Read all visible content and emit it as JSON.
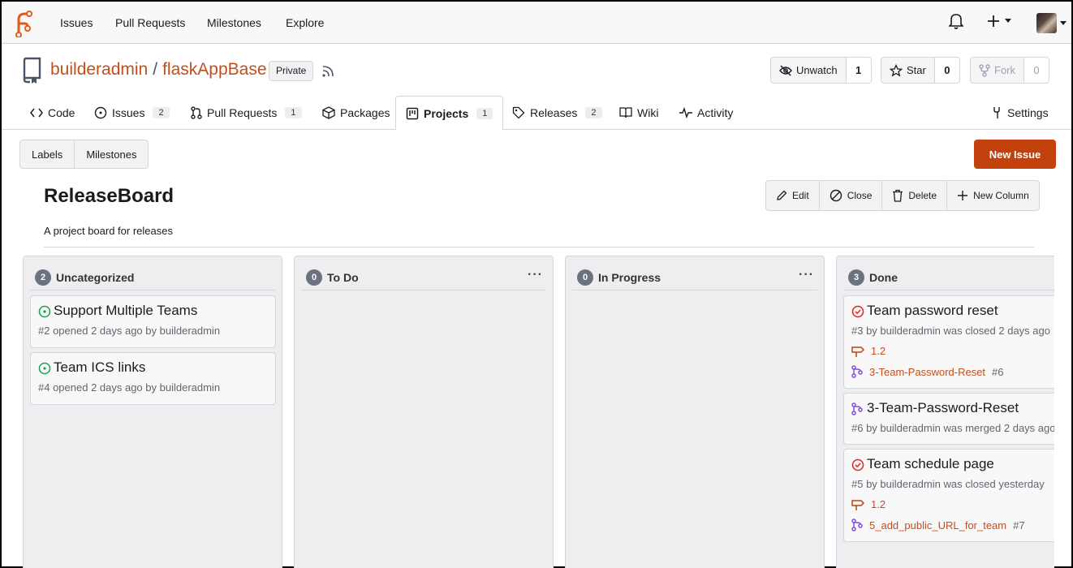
{
  "nav": {
    "links": [
      "Issues",
      "Pull Requests",
      "Milestones",
      "Explore"
    ],
    "icons": [
      "bell-icon",
      "plus-icon",
      "avatar"
    ]
  },
  "repo": {
    "owner": "builderadmin",
    "separator": "/",
    "name": "flaskAppBase",
    "visibility": "Private",
    "watch_label": "Unwatch",
    "watch_count": "1",
    "star_label": "Star",
    "star_count": "0",
    "fork_label": "Fork",
    "fork_count": "0"
  },
  "tabs": {
    "code": "Code",
    "issues": "Issues",
    "issues_count": "2",
    "pulls": "Pull Requests",
    "pulls_count": "1",
    "packages": "Packages",
    "projects": "Projects",
    "projects_count": "1",
    "releases": "Releases",
    "releases_count": "2",
    "wiki": "Wiki",
    "activity": "Activity",
    "settings": "Settings"
  },
  "subnav": {
    "labels": "Labels",
    "milestones": "Milestones",
    "new_issue": "New Issue"
  },
  "project": {
    "title": "ReleaseBoard",
    "description": "A project board for releases",
    "actions": {
      "edit": "Edit",
      "close": "Close",
      "delete": "Delete",
      "new_column": "New Column"
    }
  },
  "columns": [
    {
      "title": "Uncategorized",
      "count": "2",
      "cards": [
        {
          "title": "Support Multiple Teams",
          "meta": "#2 opened 2 days ago by builderadmin"
        },
        {
          "title": "Team ICS links",
          "meta": "#4 opened 2 days ago by builderadmin"
        }
      ]
    },
    {
      "title": "To Do",
      "count": "0",
      "menu": "···"
    },
    {
      "title": "In Progress",
      "count": "0",
      "menu": "···"
    },
    {
      "title": "Done",
      "count": "3",
      "cards": [
        {
          "title": "Team password reset",
          "meta": "#3 by builderadmin was closed 2 days ago",
          "milestone": "1.2",
          "branch": "3-Team-Password-Reset",
          "branch_ref": "#6"
        },
        {
          "title": "3-Team-Password-Reset",
          "meta": "#6 by builderadmin was merged 2 days ago"
        },
        {
          "title": "Team schedule page",
          "meta": "#5 by builderadmin was closed yesterday",
          "milestone": "1.2",
          "branch": "5_add_public_URL_for_team",
          "branch_ref": "#7"
        }
      ]
    }
  ],
  "colors": {
    "accent": "#c2410c",
    "link": "#c34e1c",
    "open_green": "#16a34a",
    "closed_red": "#dc2626",
    "pr_purple": "#8250df"
  }
}
